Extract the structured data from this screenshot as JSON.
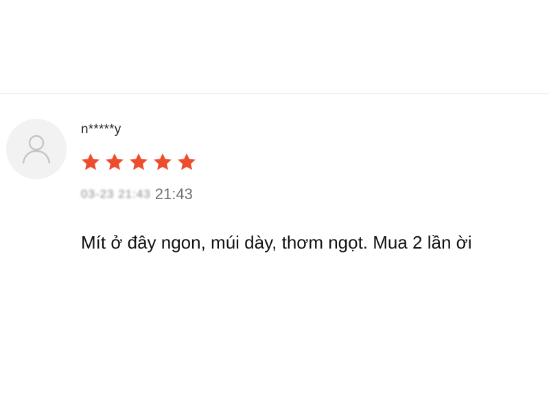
{
  "review": {
    "username": "n*****y",
    "rating": 5,
    "rating_max": 5,
    "star_color": "#ee4d2d",
    "date_masked": "03-23 21:43",
    "time": "21:43",
    "comment": "Mít ở đây ngon, múi dày, thơm ngọt. Mua 2 lần ời"
  },
  "icons": {
    "avatar": "user-avatar-placeholder-icon",
    "star": "star-icon"
  }
}
